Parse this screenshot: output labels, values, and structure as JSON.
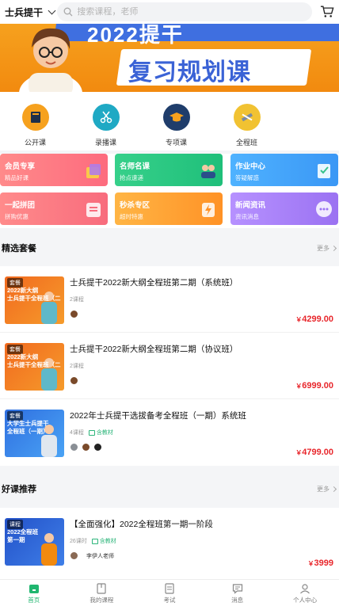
{
  "header": {
    "location": "士兵提干",
    "search_placeholder": "搜索课程，老师"
  },
  "banner": {
    "year_text": "2022提干",
    "title": "复习规划课"
  },
  "categories": [
    {
      "label": "公开课",
      "icon": "book-icon",
      "color": "#f6a11e"
    },
    {
      "label": "录播课",
      "icon": "video-scissors-icon",
      "color": "#1fa9c4"
    },
    {
      "label": "专项课",
      "icon": "graduation-cap-icon",
      "color": "#1f3d6b"
    },
    {
      "label": "全程班",
      "icon": "pen-ruler-icon",
      "color": "#f1c232"
    }
  ],
  "feature_cards": [
    {
      "title": "会员专享",
      "subtitle": "精品好课",
      "color_from": "#ff8a8a",
      "color_to": "#fd6b7e"
    },
    {
      "title": "名师名课",
      "subtitle": "抢点速递",
      "color_from": "#36d08a",
      "color_to": "#1fbf7a"
    },
    {
      "title": "作业中心",
      "subtitle": "答疑解惑",
      "color_from": "#4fb2ff",
      "color_to": "#3a97f5"
    },
    {
      "title": "一起拼团",
      "subtitle": "拼购优惠",
      "color_from": "#ff8b8b",
      "color_to": "#f86c7d"
    },
    {
      "title": "秒杀专区",
      "subtitle": "超时特惠",
      "color_from": "#ffb545",
      "color_to": "#ff9226"
    },
    {
      "title": "新闻资讯",
      "subtitle": "资讯消息",
      "color_from": "#b691ff",
      "color_to": "#9b72f2"
    }
  ],
  "sections": {
    "featured": {
      "title": "精选套餐",
      "more": "更多"
    },
    "recommended": {
      "title": "好课推荐",
      "more": "更多"
    }
  },
  "featured_courses": [
    {
      "tag": "套餐",
      "thumb_title": "2022新大纲\n士兵提干全程班（二期）",
      "name": "士兵提干2022新大纲全程班第二期（系统班）",
      "lessons": "2课程",
      "materials": "",
      "price_symbol": "￥",
      "price": "4299.00"
    },
    {
      "tag": "套餐",
      "thumb_title": "2022新大纲\n士兵提干全程班（二期）",
      "name": "士兵提干2022新大纲全程班第二期（协议班）",
      "lessons": "2课程",
      "materials": "",
      "price_symbol": "￥",
      "price": "6999.00"
    },
    {
      "tag": "套餐",
      "thumb_title": "大学生士兵提干\n全程班（一期）",
      "name": "2022年士兵提干选拔备考全程班（一期）系统班",
      "lessons": "4课程",
      "materials": "含教材",
      "price_symbol": "￥",
      "price": "4799.00"
    }
  ],
  "recommended_courses": [
    {
      "tag": "课程",
      "thumb_title": "2022全程班\n第一期",
      "name": "【全面强化】2022全程班第一期一阶段",
      "lessons": "26课时",
      "materials": "含教材",
      "teacher": "李伊人老师",
      "price_symbol": "￥",
      "price": "3999"
    }
  ],
  "tabbar": [
    {
      "label": "首页",
      "icon": "home-icon",
      "active": true
    },
    {
      "label": "我的课程",
      "icon": "my-courses-icon",
      "active": false
    },
    {
      "label": "考试",
      "icon": "exam-icon",
      "active": false
    },
    {
      "label": "消息",
      "icon": "message-icon",
      "active": false
    },
    {
      "label": "个人中心",
      "icon": "profile-icon",
      "active": false
    }
  ],
  "colors": {
    "accent": "#1fb66f",
    "price": "#e8262b",
    "banner": "#f28a0f"
  }
}
